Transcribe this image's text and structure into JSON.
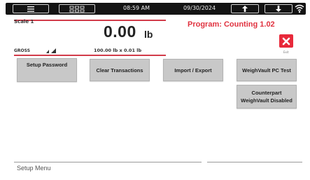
{
  "topbar": {
    "time": "08:59 AM",
    "date": "09/30/2024",
    "menu_icon": "hamburger-icon",
    "scales_icon": "scales-icon",
    "up_icon": "arrow-up-icon",
    "down_icon": "arrow-down-icon",
    "wifi_icon": "wifi-icon"
  },
  "scale": {
    "name": "Scale 1",
    "weight": "0.00",
    "unit": "lb",
    "mode": "GROSS",
    "capacity": "100.00 lb x 0.01 lb",
    "accent_color": "#d23c4a"
  },
  "program": {
    "label": "Program: Counting 1.02",
    "color": "#e0323f"
  },
  "exit": {
    "label": "Exit",
    "color": "#e8293a"
  },
  "buttons": {
    "setup_password": "Setup Password",
    "clear_transactions": "Clear Transactions",
    "import_export": "Import / Export",
    "weighvault_pc_test": "WeighVault PC Test",
    "counterpart_line1": "Counterpart",
    "counterpart_line2": "WeighVault Disabled"
  },
  "footer": {
    "title": "Setup Menu"
  }
}
